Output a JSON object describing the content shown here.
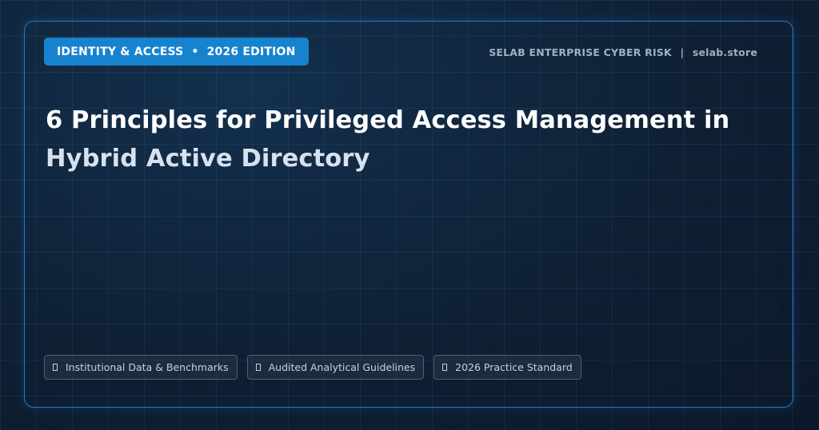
{
  "badge": {
    "category": "IDENTITY & ACCESS",
    "separator": "•",
    "edition": "2026 EDITION"
  },
  "brand": {
    "name": "SELAB ENTERPRISE CYBER RISK",
    "separator": "|",
    "site": "selab.store"
  },
  "title": {
    "line1": "6 Principles for Privileged Access Management in",
    "line2": "Hybrid Active Directory"
  },
  "pills": [
    {
      "label": "Institutional Data & Benchmarks",
      "icon": "placeholder-glyph-icon"
    },
    {
      "label": "Audited Analytical Guidelines",
      "icon": "placeholder-glyph-icon"
    },
    {
      "label": "2026 Practice Standard",
      "icon": "placeholder-glyph-icon"
    }
  ],
  "colors": {
    "background": "#0f1f33",
    "accent": "#1783cf",
    "border": "#3496e6",
    "title": "#ffffff"
  }
}
